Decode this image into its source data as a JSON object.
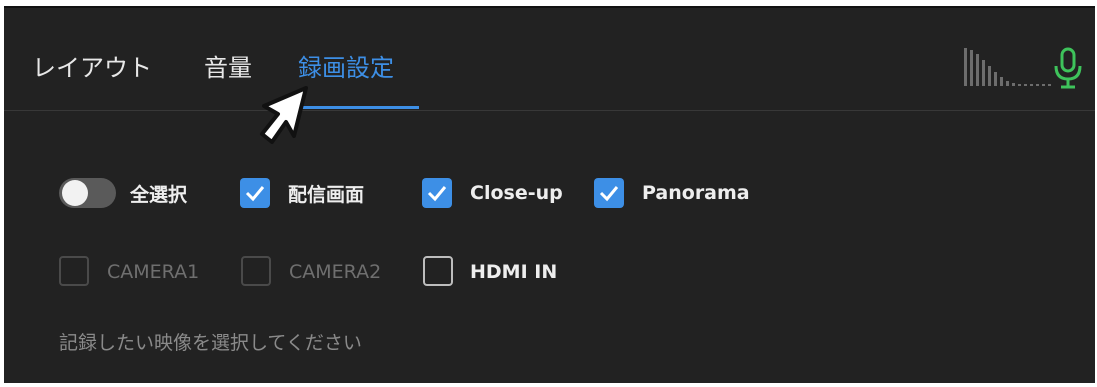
{
  "tabs": [
    {
      "label": "レイアウト",
      "active": false
    },
    {
      "label": "音量",
      "active": false
    },
    {
      "label": "録画設定",
      "active": true
    }
  ],
  "options": {
    "select_all": {
      "label": "全選択",
      "on": false
    },
    "row1": [
      {
        "label": "配信画面",
        "checked": true
      },
      {
        "label": "Close-up",
        "checked": true
      },
      {
        "label": "Panorama",
        "checked": true
      }
    ],
    "row2": [
      {
        "label": "CAMERA1",
        "checked": false,
        "disabled": true
      },
      {
        "label": "CAMERA2",
        "checked": false,
        "disabled": true
      },
      {
        "label": "HDMI IN",
        "checked": false,
        "disabled": false
      }
    ]
  },
  "hint": "記録したい映像を選択してください",
  "colors": {
    "accent": "#3d8fe6",
    "background": "#222222",
    "mic": "#3ec35b"
  },
  "icons": [
    "audio-level-meter-icon",
    "microphone-icon",
    "mouse-pointer-icon"
  ]
}
